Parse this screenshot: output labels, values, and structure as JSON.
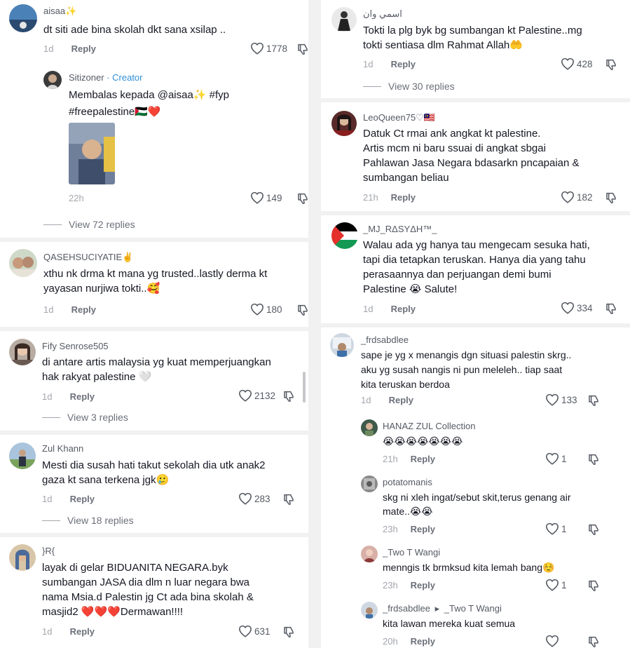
{
  "left": [
    {
      "user": "aisaa✨",
      "text": "dt siti ade bina skolah dkt sana xsilap ..",
      "time": "1d",
      "reply": "Reply",
      "likes": "1778"
    },
    {
      "user": "Sitizoner",
      "badge": "· Creator",
      "text": "Membalas kepada @aisaa✨ #fyp\n#freepalestine🇵🇸❤️",
      "time": "22h",
      "reply": "",
      "likes": "149",
      "view_replies": "View 72 replies"
    },
    {
      "user": "QASEHSUCIYATIE✌️",
      "text": "xthu nk drma kt mana yg trusted..lastly derma kt\nyayasan nurjiwa tokti..🥰",
      "time": "1d",
      "reply": "Reply",
      "likes": "180"
    },
    {
      "user": "Fify Senrose505",
      "text": "di antare artis malaysia yg kuat memperjuangkan\nhak rakyat palestine 🤍",
      "time": "1d",
      "reply": "Reply",
      "likes": "2132",
      "view_replies": "View 3 replies"
    },
    {
      "user": "Zul Khann",
      "text": "Mesti dia susah hati takut sekolah dia utk anak2\ngaza kt sana terkena jgk🥲",
      "time": "1d",
      "reply": "Reply",
      "likes": "283",
      "view_replies": "View 18 replies"
    },
    {
      "user": "}R{",
      "text": "layak di gelar BIDUANITA NEGARA.byk\nsumbangan JASA dia dlm n luar negara bwa\nnama Msia.d Palestin jg Ct ada bina skolah &\nmasjid2 ❤️❤️❤️Dermawan!!!!",
      "time": "1d",
      "reply": "Reply",
      "likes": "631"
    }
  ],
  "right": [
    {
      "user": "اسمي وان",
      "text": "Tokti la plg byk bg sumbangan kt Palestine..mg\ntokti sentiasa dlm Rahmat Allah🤲",
      "time": "1d",
      "reply": "Reply",
      "likes": "428",
      "view_replies": "View 30 replies"
    },
    {
      "user": "LeoQueen75♡🇲🇾",
      "text": "Datuk Ct rmai ank angkat kt palestine.\nArtis mcm ni baru ssuai di angkat sbgai\nPahlawan Jasa Negara bdasarkn pncapaian &\nsumbangan beliau",
      "time": "21h",
      "reply": "Reply",
      "likes": "182"
    },
    {
      "user": "_MJ_RΔSYΔH™_",
      "text": "Walau ada yg hanya tau mengecam sesuka hati,\ntapi dia tetapkan teruskan. Hanya dia yang tahu\nperasaannya dan perjuangan demi bumi\nPalestine 😭 Salute!",
      "time": "1d",
      "reply": "Reply",
      "likes": "334"
    },
    {
      "user": "_frdsabdlee",
      "text": "sape je yg x menangis dgn situasi palestin skrg..\naku yg susah nangis ni pun meleleh.. tiap saat\nkita teruskan berdoa",
      "time": "1d",
      "reply": "Reply",
      "likes": "133"
    }
  ],
  "right_replies": [
    {
      "user": "HANAZ ZUL Collection",
      "text": "😭😭😭😭😭😭😭",
      "time": "21h",
      "reply": "Reply",
      "likes": "1"
    },
    {
      "user": "potatomanis",
      "text": "skg ni xleh ingat/sebut skit,terus genang air\nmate..😭😭",
      "time": "23h",
      "reply": "Reply",
      "likes": "1"
    },
    {
      "user": "_Two T Wangi",
      "text": "menngis tk brmksud kita lemah bang☺️",
      "time": "23h",
      "reply": "Reply",
      "likes": "1"
    },
    {
      "user": "_frdsabdlee",
      "arrow": "▸",
      "target": "_Two T Wangi",
      "text": "kita lawan mereka kuat semua",
      "time": "20h",
      "reply": "Reply",
      "likes": ""
    }
  ],
  "icons": {
    "like": "heart-outline-icon",
    "dislike": "thumb-down-icon"
  }
}
